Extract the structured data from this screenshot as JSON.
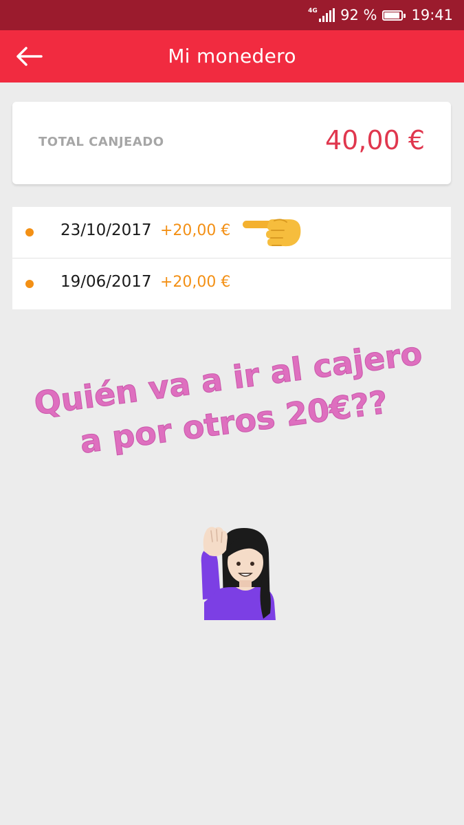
{
  "status_bar": {
    "network": "4G",
    "battery_text": "92 %",
    "battery_level": 0.92,
    "time": "19:41"
  },
  "header": {
    "title": "Mi monedero",
    "back_icon": "arrow-left-icon"
  },
  "summary": {
    "label": "TOTAL CANJEADO",
    "value": "40,00 €"
  },
  "transactions": [
    {
      "date": "23/10/2017",
      "amount": "+20,00 €"
    },
    {
      "date": "19/06/2017",
      "amount": "+20,00 €"
    }
  ],
  "overlay": {
    "line1": "Quién va a ir al cajero",
    "line2": "a por otros 20€??"
  },
  "colors": {
    "status_bar": "#9b1b2d",
    "app_bar": "#f12b40",
    "total_value": "#e0374e",
    "amount": "#f39015",
    "overlay_text": "#de6fbf"
  },
  "icons": {
    "pointing": "pointing-left-hand-icon",
    "raise_hand": "woman-raising-hand-icon"
  }
}
